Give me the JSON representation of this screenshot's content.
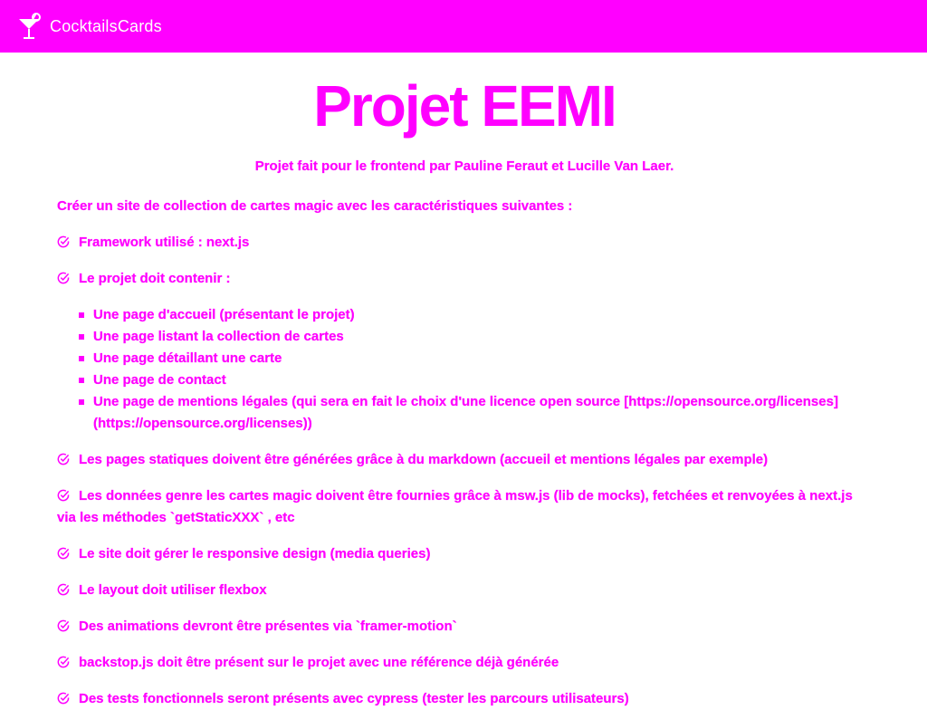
{
  "navbar": {
    "brand_name": "CocktailsCards",
    "brand_icon": "cocktail-glass-icon",
    "background": "#ff00ff"
  },
  "main": {
    "title": "Projet EEMI",
    "authors": "Projet fait pour le frontend par Pauline Feraut et Lucille Van Laer.",
    "intro": "Créer un site de collection de cartes magic avec les caractéristiques suivantes :",
    "checklist": [
      {
        "text": "Framework utilisé : next.js"
      },
      {
        "text": "Le projet doit contenir :"
      },
      {
        "text": "Les pages statiques doivent être générées grâce à du markdown (accueil et mentions légales par exemple)"
      },
      {
        "text": "Les données genre les cartes magic doivent être fournies grâce à msw.js (lib de mocks), fetchées et renvoyées à next.js via les méthodes `getStaticXXX` , etc"
      },
      {
        "text": "Le site doit gérer le responsive design (media queries)"
      },
      {
        "text": "Le layout doit utiliser flexbox"
      },
      {
        "text": "Des animations devront être présentes via `framer-motion`"
      },
      {
        "text": "backstop.js doit être présent sur le projet avec une référence déjà générée"
      },
      {
        "text": "Des tests fonctionnels seront présents avec cypress (tester les parcours utilisateurs)"
      }
    ],
    "pages": [
      "Une page d'accueil (présentant le projet)",
      "Une page listant la collection de cartes",
      "Une page détaillant une carte",
      "Une page de contact",
      "Une page de mentions légales (qui sera en fait le choix d'une licence open source [https://opensource.org/licenses](https://opensource.org/licenses))"
    ],
    "check_icon": "check-circle-icon",
    "accent_color": "#ff00ff"
  }
}
